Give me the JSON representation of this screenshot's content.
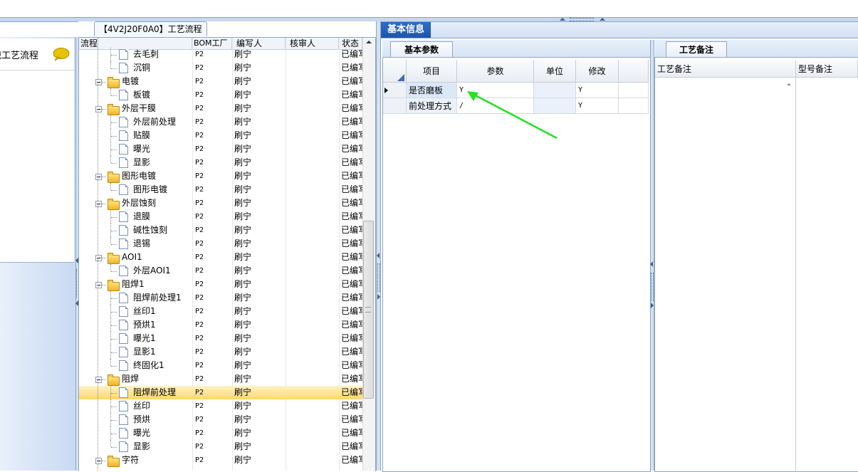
{
  "left_panel": {
    "item_label": "战工艺流程"
  },
  "tree": {
    "title": "【4V2J20F0A0】工艺流程",
    "columns": [
      "流程",
      "BOM工厂",
      "编写人",
      "核审人",
      "状态"
    ],
    "rows": [
      {
        "level": 2,
        "label": "去毛刺",
        "bom": "P2",
        "editor": "刷宁",
        "status": "已编写"
      },
      {
        "level": 2,
        "label": "沉铜",
        "bom": "P2",
        "editor": "刷宁",
        "status": "已编写"
      },
      {
        "level": 1,
        "label": "电镀",
        "bom": "P2",
        "editor": "刷宁",
        "status": "已编写"
      },
      {
        "level": 2,
        "label": "板镀",
        "bom": "P2",
        "editor": "刷宁",
        "status": "已编写"
      },
      {
        "level": 1,
        "label": "外层干膜",
        "bom": "P2",
        "editor": "刷宁",
        "status": "已编写"
      },
      {
        "level": 2,
        "label": "外层前处理",
        "bom": "P2",
        "editor": "刷宁",
        "status": "已编写"
      },
      {
        "level": 2,
        "label": "贴膜",
        "bom": "P2",
        "editor": "刷宁",
        "status": "已编写"
      },
      {
        "level": 2,
        "label": "曝光",
        "bom": "P2",
        "editor": "刷宁",
        "status": "已编写"
      },
      {
        "level": 2,
        "label": "显影",
        "bom": "P2",
        "editor": "刷宁",
        "status": "已编写"
      },
      {
        "level": 1,
        "label": "图形电镀",
        "bom": "P2",
        "editor": "刷宁",
        "status": "已编写"
      },
      {
        "level": 2,
        "label": "图形电镀",
        "bom": "P2",
        "editor": "刷宁",
        "status": "已编写"
      },
      {
        "level": 1,
        "label": "外层蚀刻",
        "bom": "P2",
        "editor": "刷宁",
        "status": "已编写"
      },
      {
        "level": 2,
        "label": "退膜",
        "bom": "P2",
        "editor": "刷宁",
        "status": "已编写"
      },
      {
        "level": 2,
        "label": "碱性蚀刻",
        "bom": "P2",
        "editor": "刷宁",
        "status": "已编写"
      },
      {
        "level": 2,
        "label": "退锡",
        "bom": "P2",
        "editor": "刷宁",
        "status": "已编写"
      },
      {
        "level": 1,
        "label": "AOI1",
        "bom": "P2",
        "editor": "刷宁",
        "status": "已编写"
      },
      {
        "level": 2,
        "label": "外层AOI1",
        "bom": "P2",
        "editor": "刷宁",
        "status": "已编写"
      },
      {
        "level": 1,
        "label": "阻焊1",
        "bom": "P2",
        "editor": "刷宁",
        "status": "已编写"
      },
      {
        "level": 2,
        "label": "阻焊前处理1",
        "bom": "P2",
        "editor": "刷宁",
        "status": "已编写"
      },
      {
        "level": 2,
        "label": "丝印1",
        "bom": "P2",
        "editor": "刷宁",
        "status": "已编写"
      },
      {
        "level": 2,
        "label": "预烘1",
        "bom": "P2",
        "editor": "刷宁",
        "status": "已编写"
      },
      {
        "level": 2,
        "label": "曝光1",
        "bom": "P2",
        "editor": "刷宁",
        "status": "已编写"
      },
      {
        "level": 2,
        "label": "显影1",
        "bom": "P2",
        "editor": "刷宁",
        "status": "已编写"
      },
      {
        "level": 2,
        "label": "终固化1",
        "bom": "P2",
        "editor": "刷宁",
        "status": "已编写"
      },
      {
        "level": 1,
        "label": "阻焊",
        "bom": "P2",
        "editor": "刷宁",
        "status": "已编写"
      },
      {
        "level": 2,
        "label": "阻焊前处理",
        "bom": "P2",
        "editor": "刷宁",
        "status": "已编写",
        "selected": true
      },
      {
        "level": 2,
        "label": "丝印",
        "bom": "P2",
        "editor": "刷宁",
        "status": "已编写"
      },
      {
        "level": 2,
        "label": "预烘",
        "bom": "P2",
        "editor": "刷宁",
        "status": "已编写"
      },
      {
        "level": 2,
        "label": "曝光",
        "bom": "P2",
        "editor": "刷宁",
        "status": "已编写"
      },
      {
        "level": 2,
        "label": "显影",
        "bom": "P2",
        "editor": "刷宁",
        "status": "已编写"
      },
      {
        "level": 1,
        "label": "字符",
        "bom": "P2",
        "editor": "刷宁",
        "status": "已编写"
      }
    ]
  },
  "info": {
    "tab_label": "基本信息",
    "basic_tab_label": "基本参数",
    "grid_columns": [
      "项目",
      "参数",
      "单位",
      "修改"
    ],
    "grid_rows": [
      {
        "item": "是否磨板",
        "param": "Y",
        "unit": "",
        "modify": "Y"
      },
      {
        "item": "前处理方式",
        "param": "/",
        "unit": "",
        "modify": "Y"
      }
    ],
    "arrow_color": "#22e022"
  },
  "notes": {
    "tab_label": "工艺备注",
    "columns": [
      "工艺备注",
      "型号备注"
    ]
  },
  "colors": {
    "accent": "#1f55ab",
    "selection": "#ffd76a",
    "border": "#8aa6c8"
  }
}
